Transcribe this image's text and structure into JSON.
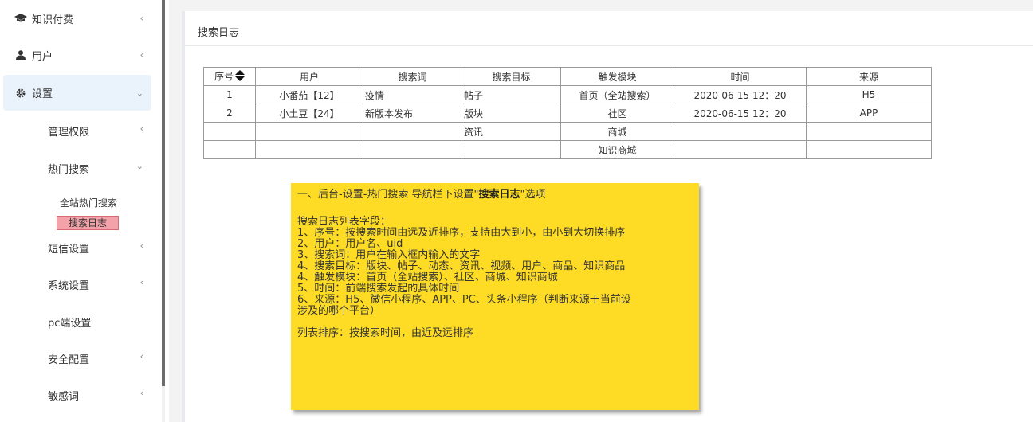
{
  "sidebar": {
    "items": [
      {
        "label": "知识付费",
        "icon": "graduation-cap-icon",
        "chevron": "‹"
      },
      {
        "label": "用户",
        "icon": "user-icon",
        "chevron": "‹"
      },
      {
        "label": "设置",
        "icon": "gear-icon",
        "chevron": "⌄"
      }
    ],
    "settings_children": [
      {
        "label": "管理权限",
        "chevron": "‹"
      },
      {
        "label": "热门搜索",
        "chevron": "⌄"
      },
      {
        "label": "短信设置",
        "chevron": "‹"
      },
      {
        "label": "系统设置",
        "chevron": "‹"
      },
      {
        "label": "pc端设置",
        "chevron": ""
      },
      {
        "label": "安全配置",
        "chevron": "‹"
      },
      {
        "label": "敏感词",
        "chevron": "‹"
      }
    ],
    "hot_search_children": [
      {
        "label": "全站热门搜索"
      },
      {
        "label": "搜索日志",
        "highlighted": true
      }
    ]
  },
  "panel": {
    "title": "搜索日志"
  },
  "table": {
    "headers": [
      "序号",
      "用户",
      "搜索词",
      "搜索目标",
      "触发模块",
      "时间",
      "来源"
    ],
    "rows": [
      [
        "1",
        "小番茄【12】",
        "疫情",
        "帖子",
        "首页（全站搜索）",
        "2020-06-15 12：20",
        "H5"
      ],
      [
        "2",
        "小土豆【24】",
        "新版本发布",
        "版块",
        "社区",
        "2020-06-15 12：20",
        "APP"
      ],
      [
        "",
        "",
        "",
        "资讯",
        "商城",
        "",
        ""
      ],
      [
        "",
        "",
        "",
        "",
        "知识商城",
        "",
        ""
      ]
    ]
  },
  "note": {
    "title_prefix": "一、后台-设置-热门搜索 导航栏下设置\"",
    "title_bold": "搜索日志",
    "title_suffix": "\"选项",
    "fields_heading": "搜索日志列表字段：",
    "fields": [
      "1、序号：按搜索时间由远及近排序，支持由大到小，由小到大切换排序",
      "2、用户：用户名、uid",
      "3、搜索词：用户在输入框内输入的文字",
      "4、搜索目标：版块、帖子、动态、资讯、视频、用户、商品、知识商品",
      "4、触发模块：首页（全站搜索）、社区、商城、知识商城",
      "5、时间：前端搜索发起的具体时间",
      "6、来源：H5、微信小程序、APP、PC、头条小程序（判断来源于当前设",
      "涉及的哪个平台）"
    ],
    "sort_rule": "列表排序：按搜索时间，由近及远排序"
  },
  "colors": {
    "note_bg": "#fedc26",
    "highlight_bg": "#f2a2a8",
    "active_menu_bg": "#eaf2fb"
  }
}
